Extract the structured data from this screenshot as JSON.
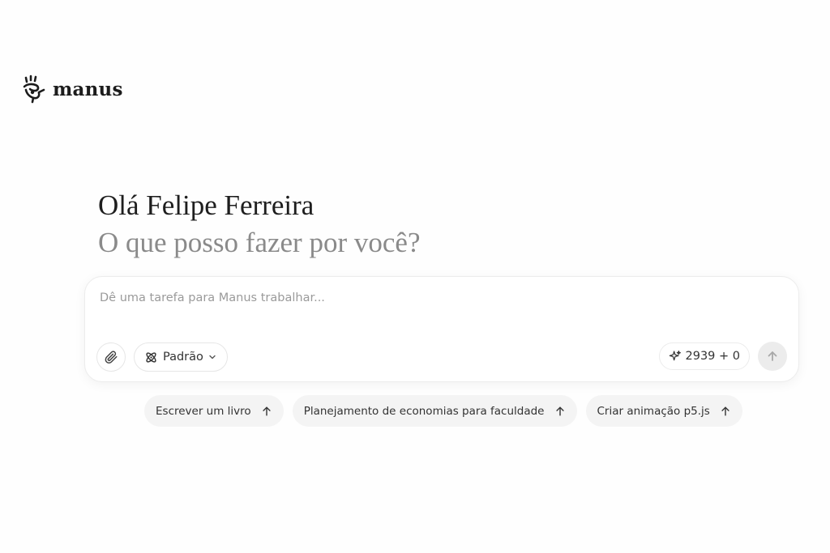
{
  "app": {
    "brand_name": "manus",
    "logo_icon": "manus-hand-icon"
  },
  "greeting": {
    "line1": "Olá Felipe Ferreira",
    "line2": "O que posso fazer por você?"
  },
  "composer": {
    "placeholder": "Dê uma tarefa para Manus trabalhar...",
    "value": "",
    "attach_icon": "paperclip-icon",
    "mode": {
      "label": "Padrão",
      "icon": "atom-icon",
      "dropdown_icon": "chevron-down-icon"
    },
    "credits": {
      "icon": "sparkle-icon",
      "text": "2939 + 0"
    },
    "send_icon": "arrow-up-icon",
    "send_enabled": false
  },
  "suggestions": [
    {
      "label": "Escrever um livro",
      "icon": "arrow-up-icon"
    },
    {
      "label": "Planejamento de economias para faculdade",
      "icon": "arrow-up-icon"
    },
    {
      "label": "Criar animação p5.js",
      "icon": "arrow-up-icon"
    }
  ],
  "colors": {
    "background": "#fefefe",
    "greeting_primary": "#1e1e1e",
    "greeting_secondary": "#8a8a8a",
    "chip_background": "#f4f4f4",
    "send_disabled": "#ececec"
  }
}
